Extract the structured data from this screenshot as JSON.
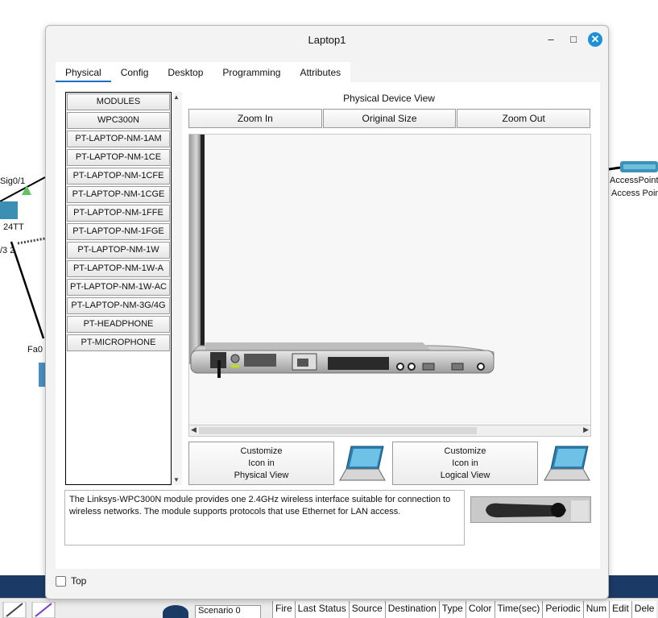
{
  "window": {
    "title": "Laptop1"
  },
  "titlebar": {
    "minimize": "–",
    "maximize": "□",
    "close": "✕"
  },
  "tabs": [
    {
      "label": "Physical",
      "active": true
    },
    {
      "label": "Config"
    },
    {
      "label": "Desktop"
    },
    {
      "label": "Programming"
    },
    {
      "label": "Attributes"
    }
  ],
  "modules": [
    "MODULES",
    "WPC300N",
    "PT-LAPTOP-NM-1AM",
    "PT-LAPTOP-NM-1CE",
    "PT-LAPTOP-NM-1CFE",
    "PT-LAPTOP-NM-1CGE",
    "PT-LAPTOP-NM-1FFE",
    "PT-LAPTOP-NM-1FGE",
    "PT-LAPTOP-NM-1W",
    "PT-LAPTOP-NM-1W-A",
    "PT-LAPTOP-NM-1W-AC",
    "PT-LAPTOP-NM-3G/4G",
    "PT-HEADPHONE",
    "PT-MICROPHONE"
  ],
  "device_view": {
    "label": "Physical Device View",
    "zoom_in": "Zoom In",
    "original_size": "Original Size",
    "zoom_out": "Zoom Out"
  },
  "customize": {
    "physical": "Customize\nIcon in\nPhysical View",
    "logical": "Customize\nIcon in\nLogical View"
  },
  "description": "The Linksys-WPC300N module provides one 2.4GHz wireless interface suitable for connection to wireless networks. The module supports protocols that use Ethernet for LAN access.",
  "footer": {
    "top_label": "Top"
  },
  "background": {
    "sig_label": "Sig0/1",
    "tt_label": "24TT",
    "port_label": "/3 2",
    "fa_label": "Fa0",
    "ap_label1": "AccessPoint",
    "ap_label2": "Access Poin",
    "scenario": "Scenario 0",
    "pdu_columns": [
      "Fire",
      "Last Status",
      "Source",
      "Destination",
      "Type",
      "Color",
      "Time(sec)",
      "Periodic",
      "Num",
      "Edit",
      "Dele"
    ]
  },
  "colors": {
    "accent": "#1e90d8",
    "tab_underline": "#1e6fbf",
    "bottom_strip": "#1b3b66"
  }
}
